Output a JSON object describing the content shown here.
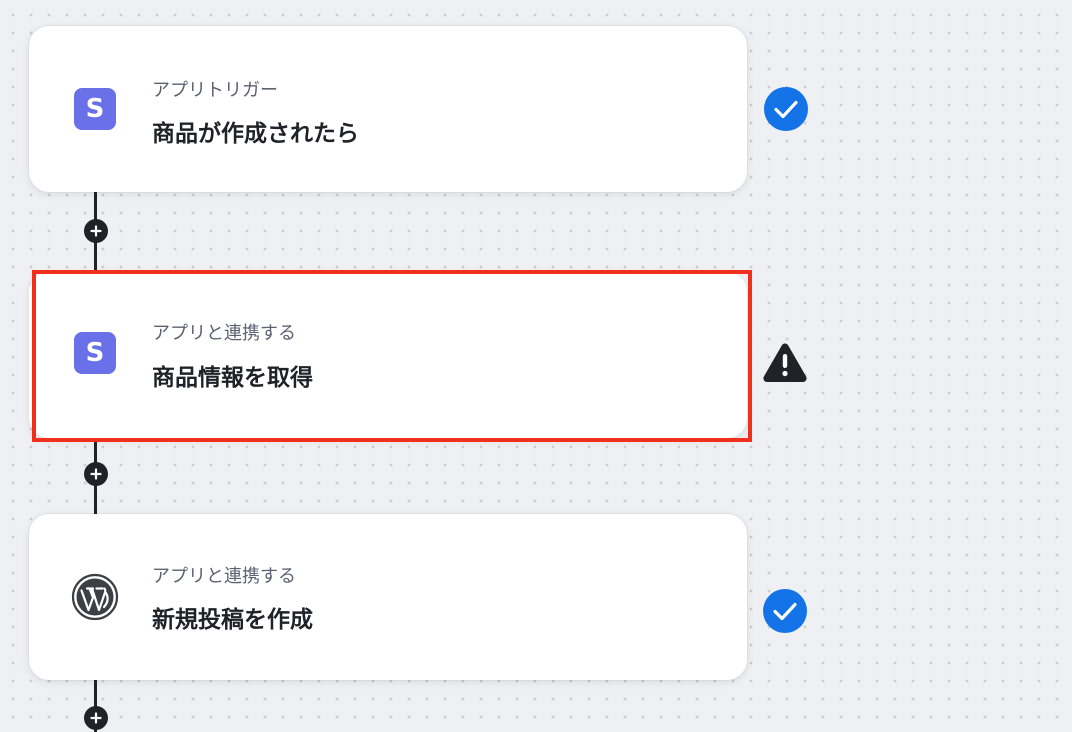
{
  "flow": {
    "steps": [
      {
        "app_icon": "stripe-icon",
        "app_letter": "S",
        "subtitle": "アプリトリガー",
        "title": "商品が作成されたら",
        "status": "check-icon"
      },
      {
        "app_icon": "stripe-icon",
        "app_letter": "S",
        "subtitle": "アプリと連携する",
        "title": "商品情報を取得",
        "status": "warning-icon",
        "highlighted": true
      },
      {
        "app_icon": "wordpress-icon",
        "subtitle": "アプリと連携する",
        "title": "新規投稿を作成",
        "status": "check-icon"
      }
    ]
  },
  "colors": {
    "stripe_brand": "#6a70e8",
    "check_blue": "#1473e6",
    "highlight_red": "#f0301c",
    "connector": "#1f2328"
  }
}
